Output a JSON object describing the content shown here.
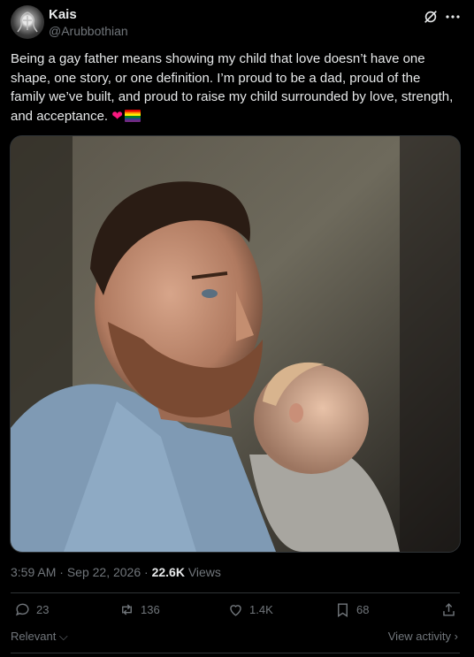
{
  "author": {
    "name": "Kais",
    "handle": "@Arubbothian"
  },
  "tweet": {
    "text": "Being a gay father means showing my child that love doesn’t have one shape, one story, or one definition. I’m proud to be a dad, proud of the family we’ve built, and proud to raise my child surrounded by love, strength, and acceptance.",
    "emojis": [
      "red-heart",
      "rainbow-flag"
    ]
  },
  "meta": {
    "time": "3:59 AM",
    "sep": " · ",
    "date": "Sep 22, 2026",
    "views_count": "22.6K",
    "views_label": " Views"
  },
  "actions": {
    "replies": "23",
    "reposts": "136",
    "likes": "1.4K",
    "bookmarks": "68"
  },
  "footer": {
    "relevant": "Relevant",
    "view_activity": "View activity"
  },
  "colors": {
    "background": "#000000",
    "text": "#e7e9ea",
    "muted": "#71767b",
    "border": "#2f3336",
    "heart": "#f91880"
  }
}
